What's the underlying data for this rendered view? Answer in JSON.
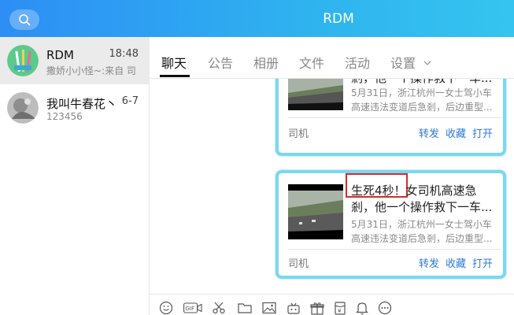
{
  "app": {
    "title": "RDM"
  },
  "contacts": [
    {
      "name": "RDM",
      "time": "18:48",
      "preview": "撒娇小小怪~:来自 司"
    },
    {
      "name": "我叫牛春花丶",
      "time": "6-7",
      "preview": "123456"
    }
  ],
  "tabs": [
    {
      "label": "聊天"
    },
    {
      "label": "公告"
    },
    {
      "label": "相册"
    },
    {
      "label": "文件"
    },
    {
      "label": "活动"
    },
    {
      "label": "设置"
    }
  ],
  "cards": [
    {
      "title_line2": "剎，他一个操作救下一车...",
      "desc_line1": "5月31日，浙江杭州一女士驾小车",
      "desc_line2": "高速违法变道后急剎，后边重型...",
      "source": "司机",
      "actions": [
        "转发",
        "收藏",
        "打开"
      ]
    },
    {
      "title_highlight": "生死4秒！",
      "title_rest": "女司机高速急",
      "title_line2": "剎，他一个操作救下一车...",
      "desc_line1": "5月31日，浙江杭州一女士驾小车",
      "desc_line2": "高速违法变道后急剎，后边重型...",
      "source": "司机",
      "actions": [
        "转发",
        "收藏",
        "打开"
      ]
    }
  ],
  "toolbar": {
    "icons": [
      "emoji-icon",
      "gif-icon",
      "scissors-icon",
      "folder-icon",
      "image-icon",
      "gamepad-icon",
      "gift-icon",
      "red-packet-icon",
      "bell-icon",
      "more-icon"
    ],
    "gif_label": "GIF"
  },
  "colors": {
    "header_gradient_start": "#2d8ef5",
    "header_gradient_end": "#35c4ef",
    "card_border": "#7ad8f1",
    "link_blue": "#2b78d8",
    "highlight_red": "#d92a2a"
  }
}
